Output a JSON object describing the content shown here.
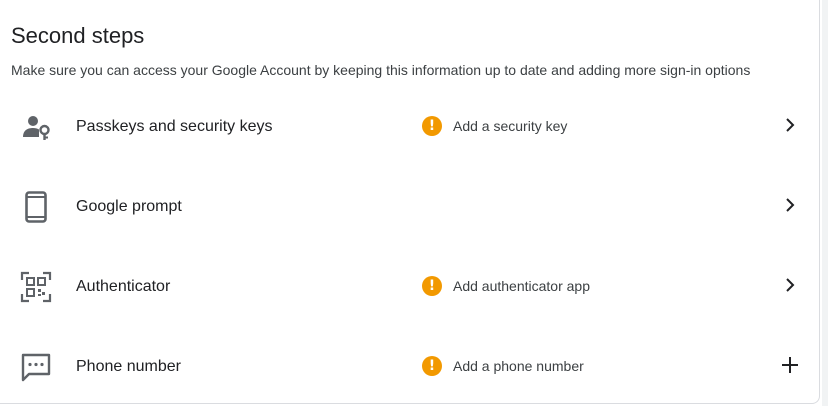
{
  "section": {
    "title": "Second steps",
    "description": "Make sure you can access your Google Account by keeping this information up to date and adding more sign-in options"
  },
  "rows": [
    {
      "label": "Passkeys and security keys",
      "icon": "passkey-person-key-icon",
      "status": "Add a security key",
      "status_icon": "warning-icon",
      "action_icon": "chevron-right-icon"
    },
    {
      "label": "Google prompt",
      "icon": "phone-device-icon",
      "status": "",
      "status_icon": "",
      "action_icon": "chevron-right-icon"
    },
    {
      "label": "Authenticator",
      "icon": "qr-code-scanner-icon",
      "status": "Add authenticator app",
      "status_icon": "warning-icon",
      "action_icon": "chevron-right-icon"
    },
    {
      "label": "Phone number",
      "icon": "sms-message-icon",
      "status": "Add a phone number",
      "status_icon": "warning-icon",
      "action_icon": "plus-icon"
    }
  ],
  "colors": {
    "warning": "#f29900",
    "icon_gray": "#5f6368",
    "text_primary": "#202124",
    "text_secondary": "#3c4043",
    "border": "#dadce0"
  },
  "warning_glyph": "!"
}
